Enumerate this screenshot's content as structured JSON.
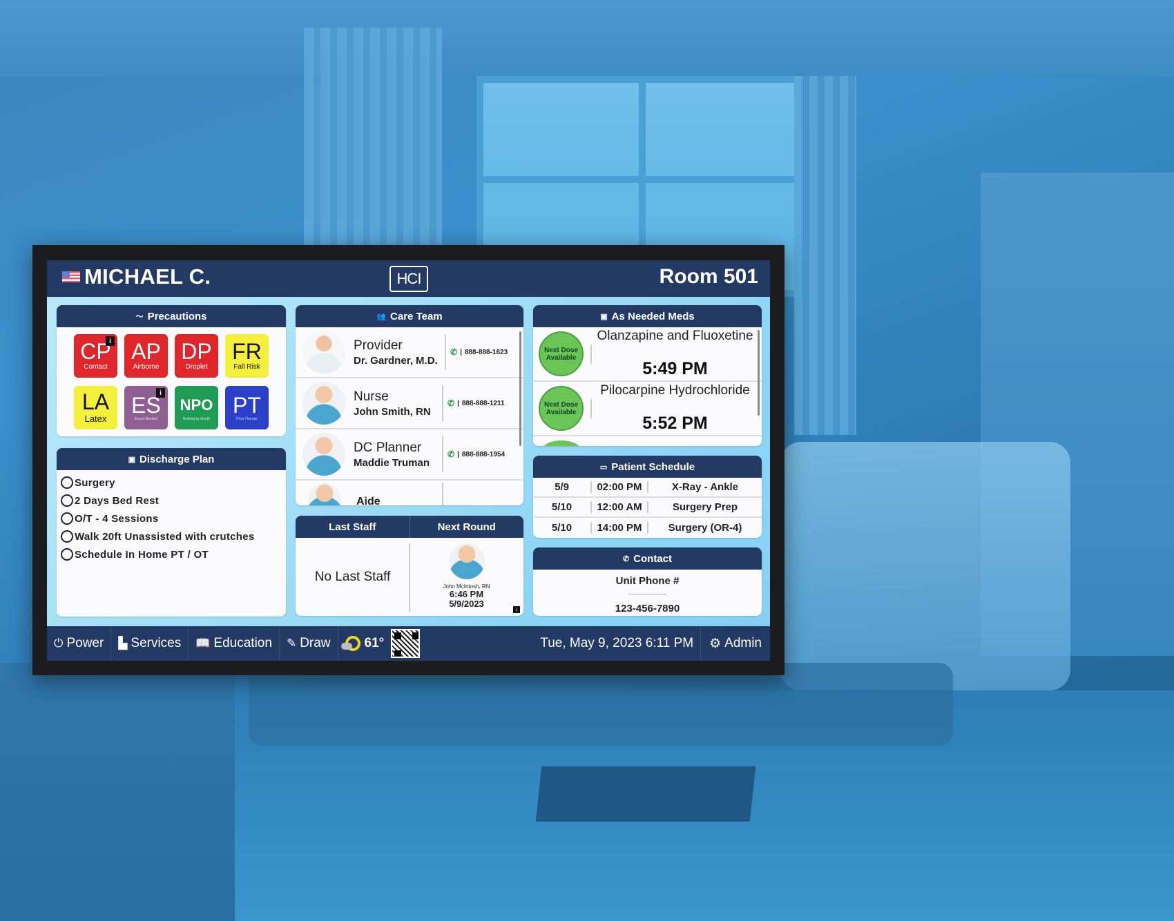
{
  "header": {
    "patient_name": "MICHAEL C.",
    "logo": "HCI",
    "room": "Room 501"
  },
  "precautions": {
    "title": "Precautions",
    "icon": "heartbeat-icon",
    "tiles": [
      {
        "abbr": "CP",
        "label": "Contact",
        "color": "#e1262b",
        "info": true
      },
      {
        "abbr": "AP",
        "label": "Airborne",
        "color": "#e1262b",
        "info": false
      },
      {
        "abbr": "DP",
        "label": "Droplet",
        "color": "#e1262b",
        "info": false
      },
      {
        "abbr": "FR",
        "label": "Fall Risk",
        "color": "#f4ef3a",
        "info": false
      },
      {
        "abbr": "LA",
        "label": "Latex",
        "color": "#f4ef3a",
        "info": false
      },
      {
        "abbr": "ES",
        "label": "Escort Needed",
        "color": "#8f5e92",
        "info": true
      },
      {
        "abbr": "NPO",
        "label": "Nothing by Mouth",
        "color": "#1f9c54",
        "info": false
      },
      {
        "abbr": "PT",
        "label": "Phys Therapy",
        "color": "#2b3fc9",
        "info": false
      }
    ],
    "info_glyph": "i"
  },
  "discharge_plan": {
    "title": "Discharge Plan",
    "items": [
      "Surgery",
      "2 Days Bed Rest",
      "O/T - 4 Sessions",
      "Walk 20ft Unassisted with crutches",
      "Schedule In Home PT / OT"
    ]
  },
  "care_team": {
    "title": "Care Team",
    "members": [
      {
        "role": "Provider",
        "name": "Dr. Gardner, M.D.",
        "phone": "888-888-1623"
      },
      {
        "role": "Nurse",
        "name": "John Smith, RN",
        "phone": "888-888-1211"
      },
      {
        "role": "DC Planner",
        "name": "Maddie Truman",
        "phone": "888-888-1954"
      },
      {
        "role": "Aide",
        "name": "",
        "phone": ""
      }
    ],
    "phone_separator": "|"
  },
  "last_staff": {
    "title": "Last Staff",
    "value": "No Last Staff"
  },
  "next_round": {
    "title": "Next Round",
    "name": "John McIntosh, RN",
    "time": "6:46 PM",
    "date": "5/9/2023",
    "info_glyph": "i"
  },
  "meds": {
    "title": "As Needed Meds",
    "items": [
      {
        "status": "Next Dose Available",
        "name": "Olanzapine and Fluoxetine",
        "time": "5:49 PM"
      },
      {
        "status": "Next Dose Available",
        "name": "Pilocarpine Hydrochloride",
        "time": "5:52 PM"
      }
    ],
    "status_color": "#6bc456"
  },
  "schedule": {
    "title": "Patient Schedule",
    "rows": [
      {
        "date": "5/9",
        "time": "02:00 PM",
        "event": "X-Ray - Ankle"
      },
      {
        "date": "5/10",
        "time": "12:00 AM",
        "event": "Surgery Prep"
      },
      {
        "date": "5/10",
        "time": "14:00 PM",
        "event": "Surgery (OR-4)"
      }
    ]
  },
  "contact": {
    "title": "Contact",
    "label": "Unit Phone #",
    "phone": "123-456-7890"
  },
  "footer": {
    "power": "Power",
    "services": "Services",
    "education": "Education",
    "draw": "Draw",
    "temperature": "61°",
    "datetime": "Tue, May 9, 2023 6:11 PM",
    "admin": "Admin"
  },
  "colors": {
    "navy": "#223a64",
    "screen_bg": "#a8e1f8",
    "phone_green": "#1e9c3a"
  }
}
